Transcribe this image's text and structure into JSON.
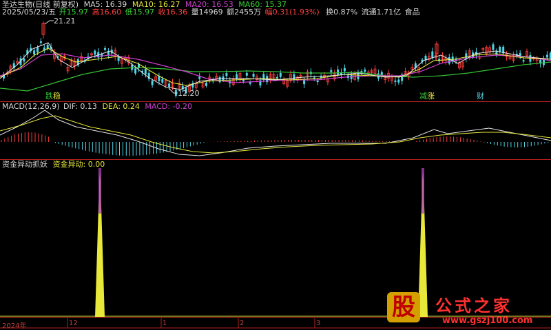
{
  "header": {
    "stock_name": "圣达生物(日线 前复权)",
    "ma5": "MA5: 16.39",
    "ma10": "MA10: 16.27",
    "ma20": "MA20: 16.53",
    "ma60": "MA60: 15.37"
  },
  "quote": {
    "date": "2025/05/23/五",
    "open": "开15.97",
    "high": "高16.60",
    "low": "低15.97",
    "close": "收16.36",
    "volume": "量14969",
    "amount": "额2455万",
    "change": "幅0.31(1.93%)",
    "turnover": "换0.87%",
    "float_cap": "流通1.71亿",
    "sector": "食品"
  },
  "price_labels": {
    "high_mark": "21.21",
    "low_mark": "12.20"
  },
  "signals": {
    "signal1_a": "跌",
    "signal1_b": "稳",
    "signal2_a": "减",
    "signal2_b": "涨",
    "signal3": "财"
  },
  "macd": {
    "title": "MACD(12,26,9)",
    "dif": "DIF: 0.13",
    "dea": "DEA: 0.24",
    "macd": "MACD: -0.20"
  },
  "indicator": {
    "title": "资金异动抓妖",
    "value": "资金异动: 0.00"
  },
  "xaxis": [
    "2024年",
    "12",
    "1",
    "2",
    "3"
  ],
  "watermark": {
    "logo_char": "股",
    "name": "公式之家",
    "url": "www.gszj100.com"
  },
  "colors": {
    "up": "#ff3c3c",
    "down": "#4fd6e8",
    "ma5": "#e0e0e0",
    "ma10": "#e8e83a",
    "ma20": "#d040d0",
    "ma60": "#36c236",
    "separator": "#b02020"
  },
  "chart_data": {
    "type": "bar",
    "title": "资金异动抓妖",
    "series": [
      {
        "name": "资金异动",
        "values": [
          0,
          1,
          0,
          1,
          0
        ]
      }
    ],
    "categories": [
      "2024年",
      "12",
      "1",
      "2",
      "3"
    ]
  }
}
